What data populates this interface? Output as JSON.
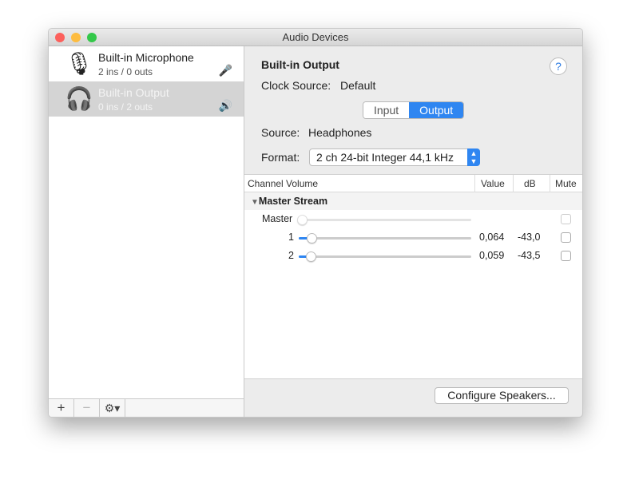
{
  "window": {
    "title": "Audio Devices"
  },
  "devices": [
    {
      "name": "Built-in Microphone",
      "sub": "2 ins / 0 outs",
      "icon": "microphone-icon",
      "status_icon": "mic-icon",
      "selected": false
    },
    {
      "name": "Built-in Output",
      "sub": "0 ins / 2 outs",
      "icon": "headphones-icon",
      "status_icon": "speaker-icon",
      "selected": true
    }
  ],
  "sidebar_bar": {
    "add": "+",
    "remove": "−",
    "gear": "⚙▾"
  },
  "main": {
    "title": "Built-in Output",
    "clock_label": "Clock Source:",
    "clock_value": "Default",
    "help": "?",
    "tabs": [
      "Input",
      "Output"
    ],
    "active_tab": "Output",
    "source_label": "Source:",
    "source_value": "Headphones",
    "format_label": "Format:",
    "format_value": "2 ch 24-bit Integer 44,1 kHz",
    "table": {
      "headers": {
        "channel": "Channel Volume",
        "value": "Value",
        "db": "dB",
        "mute": "Mute"
      },
      "group": "Master Stream",
      "rows": [
        {
          "label": "Master",
          "value": "",
          "db": "",
          "level": 0,
          "enabled": false
        },
        {
          "label": "1",
          "value": "0,064",
          "db": "-43,0",
          "level": 0.064,
          "enabled": true
        },
        {
          "label": "2",
          "value": "0,059",
          "db": "-43,5",
          "level": 0.059,
          "enabled": true
        }
      ]
    },
    "configure_button": "Configure Speakers..."
  },
  "colors": {
    "accent": "#2f86f1"
  }
}
